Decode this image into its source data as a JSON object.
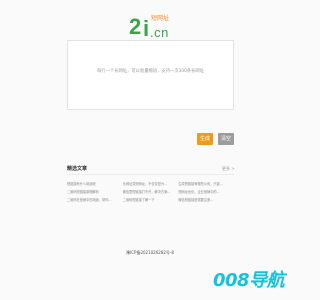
{
  "logo": {
    "mark_2": "2",
    "mark_i": "i",
    "mark_cn": ".cn",
    "brand_text": "短网址",
    "colors": {
      "green": "#3aa44a",
      "orange": "#f08a2a"
    }
  },
  "input": {
    "placeholder": "每行一个长网址，可以批量缩短，支持一次300条长网址"
  },
  "actions": {
    "generate_label": "生成",
    "clear_label": "清空",
    "colors": {
      "generate": "#f09a1c",
      "clear": "#9c9c9c"
    }
  },
  "articles_section": {
    "title": "精选文章",
    "more_label": "更多 >",
    "rows": [
      [
        "短链接有什么用途呢",
        "长网址变短网址，不仅仅是为...",
        "生成短链接有哪些公司，只能..."
      ],
      [
        "二维码短链接原理解析",
        "微信里短链接打不开，解决方案...",
        "短网址优化，企业营销中的..."
      ],
      [
        "二维码在营销中的用途，帮你...",
        "二维码短链接了解一下",
        "微信短链接是需要注册..."
      ]
    ]
  },
  "footer": {
    "icp": "豫ICP备2021026282号-8",
    "site_logo": "008导航",
    "logo_color": "#15c2dd"
  }
}
